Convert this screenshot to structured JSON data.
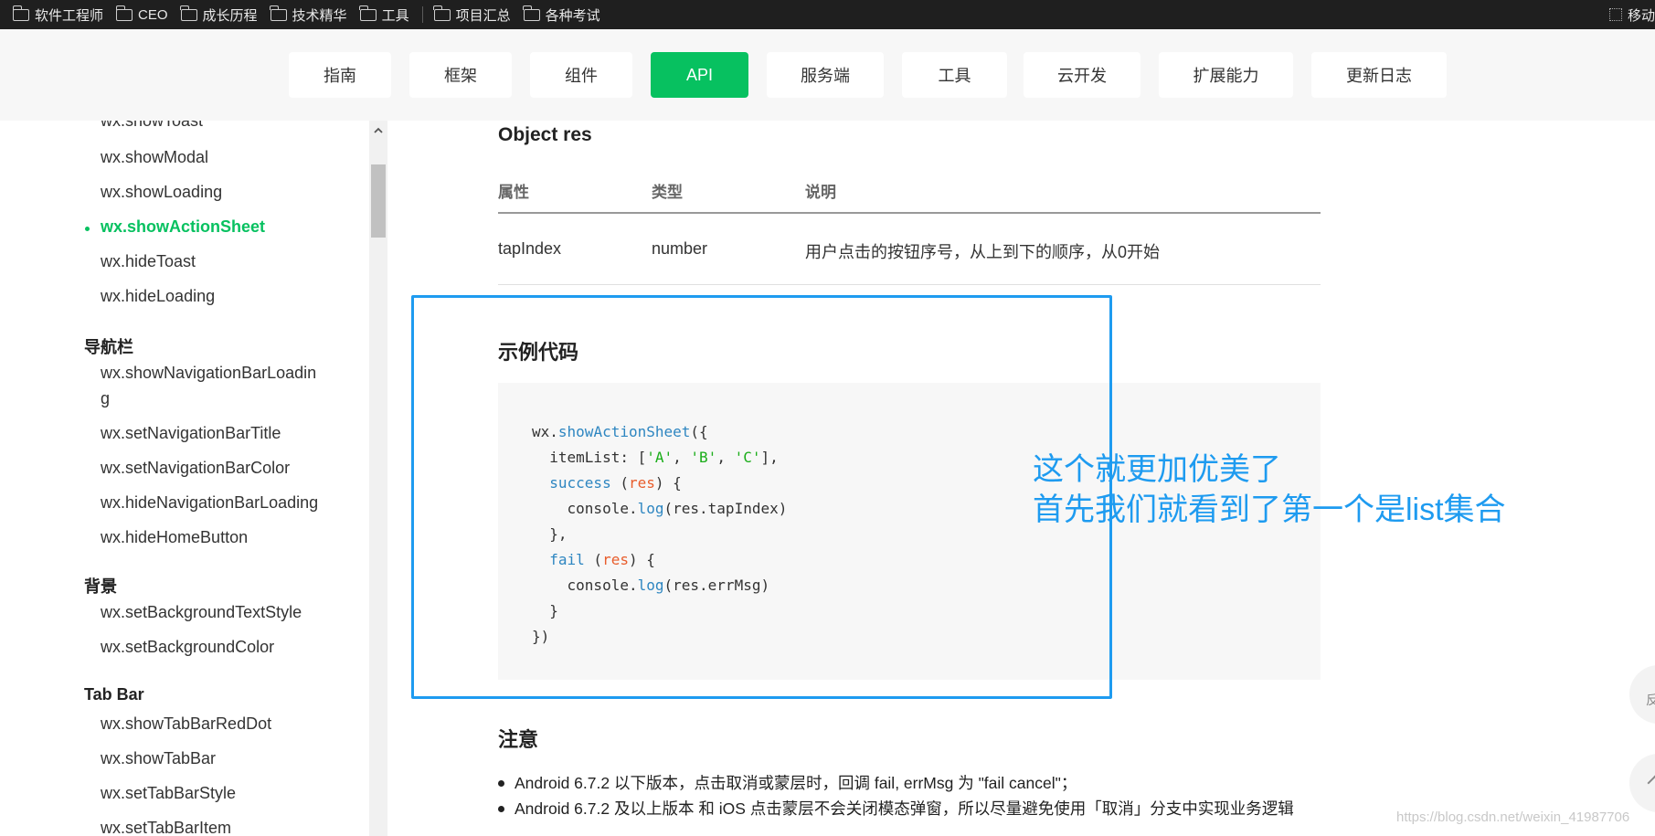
{
  "bookmarks": {
    "items": [
      "软件工程师",
      "CEO",
      "成长历程",
      "技术精华",
      "工具",
      "项目汇总",
      "各种考试"
    ],
    "right_label": "移动"
  },
  "topnav": {
    "tabs": [
      "指南",
      "框架",
      "组件",
      "API",
      "服务端",
      "工具",
      "云开发",
      "扩展能力",
      "更新日志"
    ],
    "active_tab": "API",
    "accent_color": "#07c160"
  },
  "sidebar": {
    "items": {
      "show_toast": "wx.showToast",
      "show_modal": "wx.showModal",
      "show_loading": "wx.showLoading",
      "show_action_sheet": "wx.showActionSheet",
      "hide_toast": "wx.hideToast",
      "hide_loading": "wx.hideLoading",
      "nav_heading": "导航栏",
      "show_nav_loading_1": "wx.showNavigationBarLoadin",
      "show_nav_loading_2": "g",
      "set_nav_title": "wx.setNavigationBarTitle",
      "set_nav_color": "wx.setNavigationBarColor",
      "hide_nav_loading": "wx.hideNavigationBarLoading",
      "hide_home_button": "wx.hideHomeButton",
      "bg_heading": "背景",
      "set_bg_text_style": "wx.setBackgroundTextStyle",
      "set_bg_color": "wx.setBackgroundColor",
      "tabbar_heading": "Tab Bar",
      "show_tabbar_reddot": "wx.showTabBarRedDot",
      "show_tabbar": "wx.showTabBar",
      "set_tabbar_style": "wx.setTabBarStyle",
      "set_tabbar_item": "wx.setTabBarItem"
    },
    "active_item": "wx.showActionSheet"
  },
  "content": {
    "object_heading": "Object res",
    "table": {
      "headers": [
        "属性",
        "类型",
        "说明"
      ],
      "rows": [
        [
          "tapIndex",
          "number",
          "用户点击的按钮序号，从上到下的顺序，从0开始"
        ]
      ]
    },
    "sample_heading": "示例代码",
    "code": {
      "l1_obj": "wx.",
      "l1_fn": "showActionSheet",
      "l1_end": "({",
      "l2_a": "  itemList: [",
      "l2_s1": "'A'",
      "l2_c1": ", ",
      "l2_s2": "'B'",
      "l2_c2": ", ",
      "l2_s3": "'C'",
      "l2_end": "],",
      "l3_fn": "  success",
      "l3_a": " (",
      "l3_arg": "res",
      "l3_end": ") {",
      "l4_a": "    console.",
      "l4_fn": "log",
      "l4_end": "(res.tapIndex)",
      "l5": "  },",
      "l6_fn": "  fail",
      "l6_a": " (",
      "l6_arg": "res",
      "l6_end": ") {",
      "l7_a": "    console.",
      "l7_fn": "log",
      "l7_end": "(res.errMsg)",
      "l8": "  }",
      "l9": "})"
    },
    "note_heading": "注意",
    "notes": [
      "Android 6.7.2 以下版本，点击取消或蒙层时，回调 fail, errMsg 为 \"fail cancel\"；",
      "Android 6.7.2 及以上版本 和 iOS 点击蒙层不会关闭模态弹窗，所以尽量避免使用「取消」分支中实现业务逻辑"
    ]
  },
  "annotation": {
    "line1": "这个就更加优美了",
    "line2": "首先我们就看到了第一个是list集合",
    "color": "#1e9bf0"
  },
  "floating": {
    "feedback_label": "反"
  },
  "watermark": "https://blog.csdn.net/weixin_41987706"
}
